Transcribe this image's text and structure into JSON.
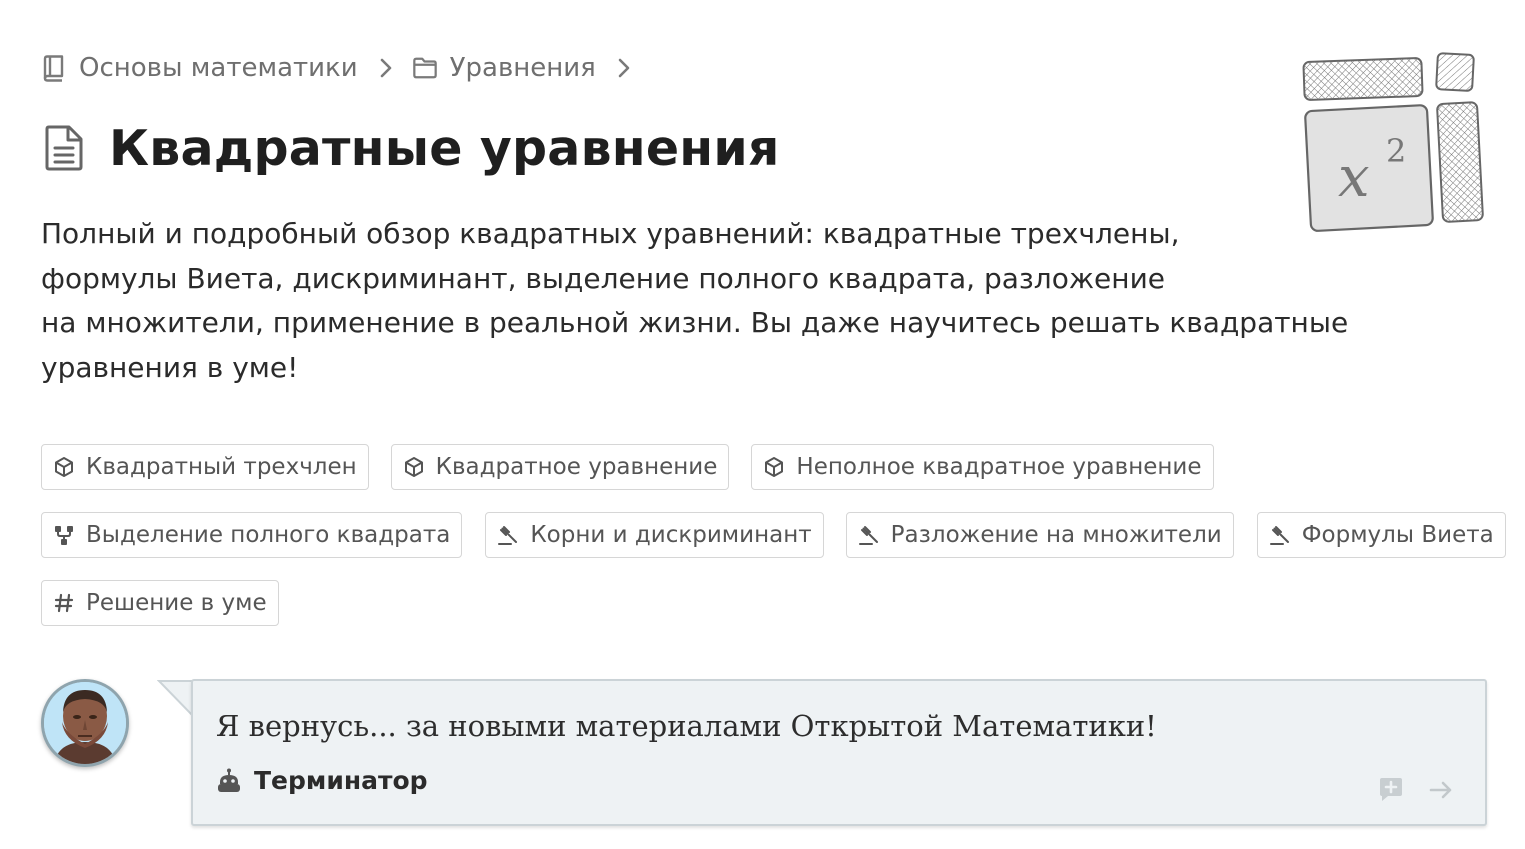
{
  "breadcrumb": {
    "items": [
      {
        "label": "Основы математики",
        "icon": "book-icon"
      },
      {
        "label": "Уравнения",
        "icon": "folder-icon"
      }
    ]
  },
  "page": {
    "title": "Квадратные уравнения",
    "title_icon": "document-icon",
    "description_lines": [
      "Полный и подробный обзор квадратных уравнений: квадратные трехчлены,",
      "формулы Виета, дискриминант, выделение полного квадрата, разложение",
      "на множители, применение в реальной жизни. Вы даже научитесь решать квадратные",
      "уравнения в уме!"
    ]
  },
  "illustration": {
    "formula_base": "x",
    "formula_exponent": "2"
  },
  "tags": [
    [
      {
        "label": "Квадратный трехчлен",
        "icon": "cube-icon"
      },
      {
        "label": "Квадратное уравнение",
        "icon": "cube-icon"
      },
      {
        "label": "Неполное квадратное уравнение",
        "icon": "cube-icon"
      }
    ],
    [
      {
        "label": "Выделение полного квадрата",
        "icon": "fork-icon"
      },
      {
        "label": "Корни и дискриминант",
        "icon": "gavel-icon"
      },
      {
        "label": "Разложение на множители",
        "icon": "gavel-icon"
      },
      {
        "label": "Формулы Виета",
        "icon": "gavel-icon"
      }
    ],
    [
      {
        "label": "Решение в уме",
        "icon": "hash-icon"
      }
    ]
  ],
  "quote": {
    "text": "Я вернусь... за новыми материалами Открытой Математики!",
    "author": "Терминатор",
    "author_icon": "robot-icon",
    "actions": [
      "add-comment-icon",
      "arrow-right-icon"
    ]
  },
  "colors": {
    "text": "#222222",
    "muted": "#6f6f6f",
    "tag_border": "#d6d6d6",
    "quote_bg": "#eef2f4",
    "quote_border": "#cbd3d7"
  }
}
